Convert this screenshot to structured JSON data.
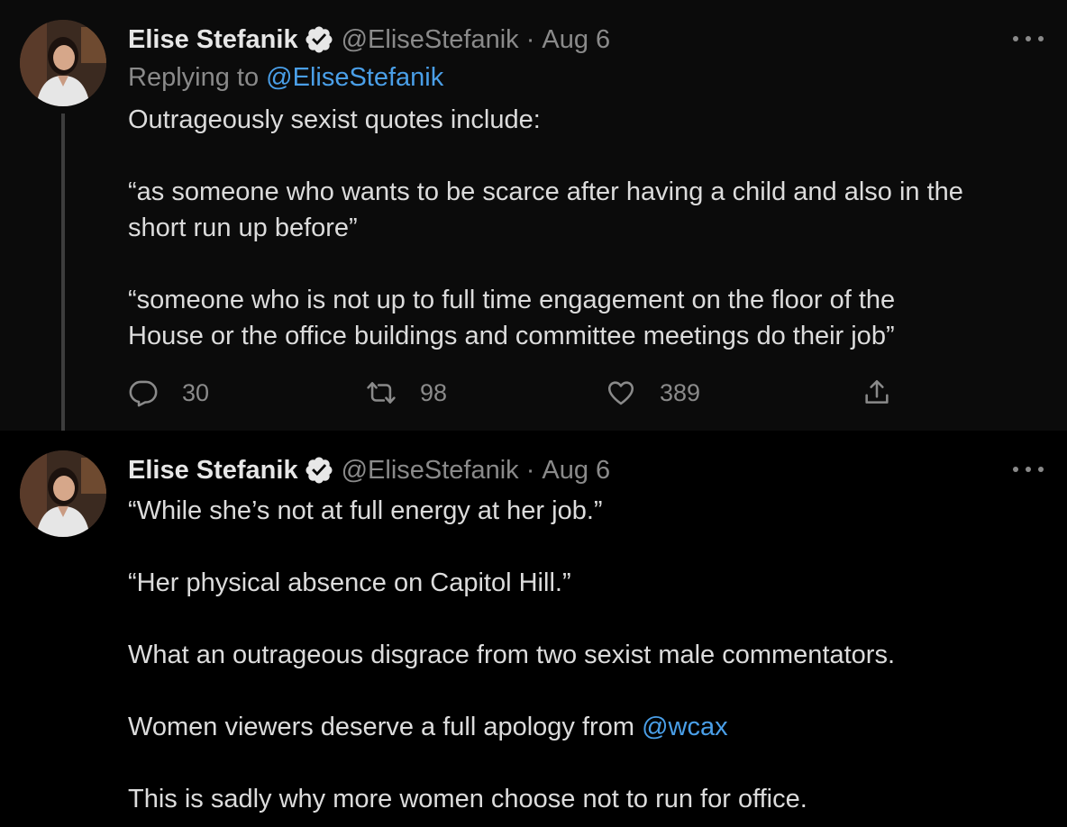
{
  "tweets": [
    {
      "author_name": "Elise Stefanik",
      "handle": "@EliseStefanik",
      "separator": "·",
      "date": "Aug 6",
      "replying_prefix": "Replying to",
      "replying_to": "@EliseStefanik",
      "lines": [
        "Outrageously sexist quotes include:",
        "“as someone who wants to be scarce after having a child and also in the",
        "short run up before”",
        "“someone who is not up to full time engagement on the floor of the",
        "House or the office buildings and committee meetings do their job”"
      ],
      "replies": "30",
      "retweets": "98",
      "likes": "389"
    },
    {
      "author_name": "Elise Stefanik",
      "handle": "@EliseStefanik",
      "separator": "·",
      "date": "Aug 6",
      "lines": [
        "“While she’s not at full energy at her job.”",
        "“Her physical absence on Capitol Hill.”",
        "What an outrageous disgrace from two sexist male commentators.",
        "Women viewers deserve a full apology from",
        "This is sadly why more women choose not to run for office."
      ],
      "mention": "@wcax"
    }
  ],
  "colors": {
    "accent": "#4a9fe8",
    "muted": "#8a8a8a",
    "text": "#dcdcdc"
  },
  "icons": [
    "verified-icon",
    "more-icon",
    "reply-icon",
    "retweet-icon",
    "like-icon",
    "share-icon"
  ]
}
